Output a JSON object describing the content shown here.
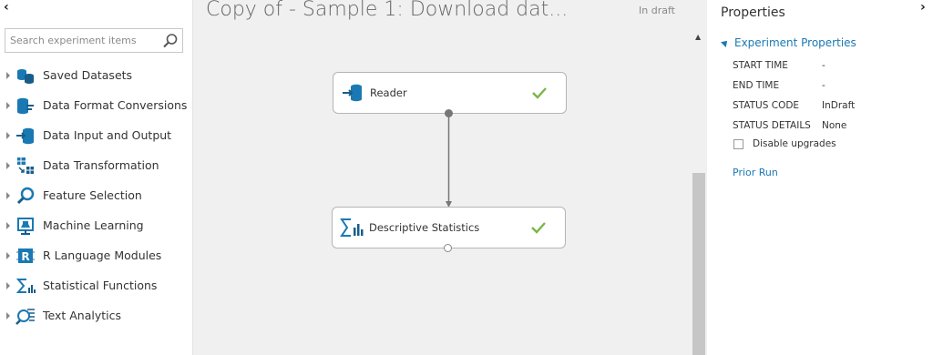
{
  "left_pane": {
    "collapse_glyph": "‹",
    "search": {
      "placeholder": "Search experiment items",
      "icon": "search-icon"
    },
    "items": [
      {
        "label": "Saved Datasets",
        "icon": "saved-datasets-icon"
      },
      {
        "label": "Data Format Conversions",
        "icon": "data-format-conversions-icon"
      },
      {
        "label": "Data Input and Output",
        "icon": "data-input-output-icon"
      },
      {
        "label": "Data Transformation",
        "icon": "data-transformation-icon"
      },
      {
        "label": "Feature Selection",
        "icon": "feature-selection-icon"
      },
      {
        "label": "Machine Learning",
        "icon": "machine-learning-icon"
      },
      {
        "label": "R Language Modules",
        "icon": "r-language-icon"
      },
      {
        "label": "Statistical Functions",
        "icon": "statistical-functions-icon"
      },
      {
        "label": "Text Analytics",
        "icon": "text-analytics-icon"
      }
    ]
  },
  "canvas": {
    "title": "Copy of - Sample 1: Download dat...",
    "status": "In draft",
    "modules": [
      {
        "label": "Reader",
        "icon": "reader-icon",
        "status_icon": "check-icon"
      },
      {
        "label": "Descriptive Statistics",
        "icon": "statistics-icon",
        "status_icon": "check-icon"
      }
    ]
  },
  "properties": {
    "header": "Properties",
    "collapse_glyph": "›",
    "section": "Experiment Properties",
    "rows": [
      {
        "key": "START TIME",
        "value": "-"
      },
      {
        "key": "END TIME",
        "value": "-"
      },
      {
        "key": "STATUS CODE",
        "value": "InDraft"
      },
      {
        "key": "STATUS DETAILS",
        "value": "None"
      }
    ],
    "disable_upgrades": {
      "label": "Disable upgrades",
      "checked": false
    },
    "prior_run": "Prior Run"
  },
  "colors": {
    "accent": "#1a79b3",
    "success": "#7ab648",
    "canvas_bg": "#f0f0f0"
  }
}
